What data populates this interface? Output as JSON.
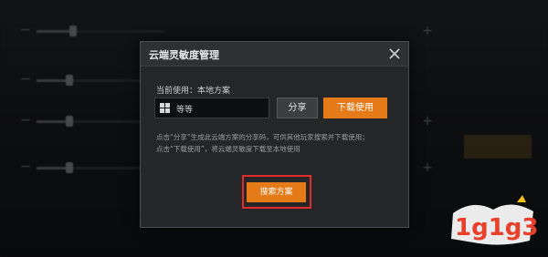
{
  "background": {
    "labels": [
      "",
      "",
      "",
      "",
      "",
      "",
      ""
    ],
    "right_menu": [
      "",
      "",
      "",
      "",
      "",
      ""
    ]
  },
  "modal": {
    "title": "云端灵敏度管理",
    "current_label": "当前使用：本地方案",
    "code_value": "等等",
    "share_label": "分享",
    "download_label": "下载使用",
    "info_line_1": "点击“分享”生成此云端方案的分享码，可供其他玩家搜索并下载使用；",
    "info_line_2": "点击“下载使用”，将云端灵敏度下载至本地使用",
    "search_label": "搜索方案"
  },
  "watermark": {
    "text": "1g1g3"
  },
  "colors": {
    "accent": "#e47b18",
    "highlight_box": "#e22b2b"
  }
}
